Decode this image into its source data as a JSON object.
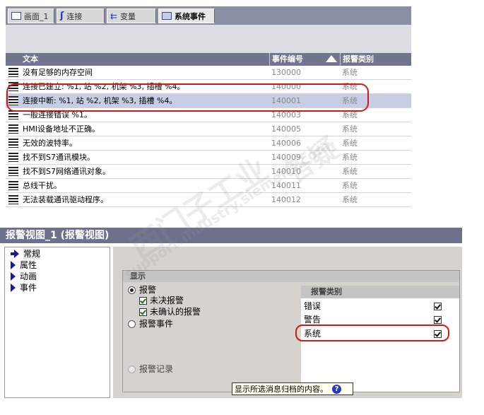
{
  "tabs": [
    {
      "label": "画面_1",
      "active": false
    },
    {
      "label": "连接",
      "active": false
    },
    {
      "label": "变量",
      "active": false
    },
    {
      "label": "系统事件",
      "active": true
    }
  ],
  "grid": {
    "columns": [
      "文本",
      "事件编号",
      "报警类别"
    ],
    "rows": [
      {
        "text": "没有足够的内存空间",
        "id": "130000",
        "cat": "系统",
        "selected": false
      },
      {
        "text": "连接已建立: %1,  站 %2,  机架 %3,  插槽 %4。",
        "id": "140000",
        "cat": "系统",
        "selected": false
      },
      {
        "text": "连接中断: %1, 站 %2, 机架 %3, 插槽 %4。",
        "id": "140001",
        "cat": "系统",
        "selected": true
      },
      {
        "text": "一般连接错误 %1。",
        "id": "140003",
        "cat": "系统",
        "selected": false
      },
      {
        "text": "HMI设备地址不正确。",
        "id": "140005",
        "cat": "系统",
        "selected": false
      },
      {
        "text": "无效的波特率。",
        "id": "140006",
        "cat": "系统",
        "selected": false
      },
      {
        "text": "找不到S7通讯模块。",
        "id": "140009",
        "cat": "系统",
        "selected": false
      },
      {
        "text": "找不到S7网络通讯对象。",
        "id": "140010",
        "cat": "系统",
        "selected": false
      },
      {
        "text": "总线干扰。",
        "id": "140011",
        "cat": "系统",
        "selected": false
      },
      {
        "text": "无法装载通讯驱动程序。",
        "id": "140012",
        "cat": "系统",
        "selected": false
      }
    ]
  },
  "props": {
    "title": "报警视图_1 (报警视图)",
    "nav": [
      "常规",
      "属性",
      "动画",
      "事件"
    ],
    "group_title": "显示",
    "radio_alarm": "报警",
    "chk_pending": "未决报警",
    "chk_unack": "未确认的报警",
    "radio_events": "报警事件",
    "radio_log": "报警记录",
    "cat_header": "报警类别",
    "categories": [
      "错误",
      "警告",
      "系统"
    ],
    "tooltip": "显示所选消息归档的内容。",
    "help": "?"
  },
  "watermark": {
    "line1": "西门子工业",
    "line2": "support.industry.siemens.com",
    "line3": "答疑"
  },
  "colors": {
    "highlight_ring": "#d01818",
    "selected_row": "#c8cde6",
    "header": "#71758f"
  }
}
